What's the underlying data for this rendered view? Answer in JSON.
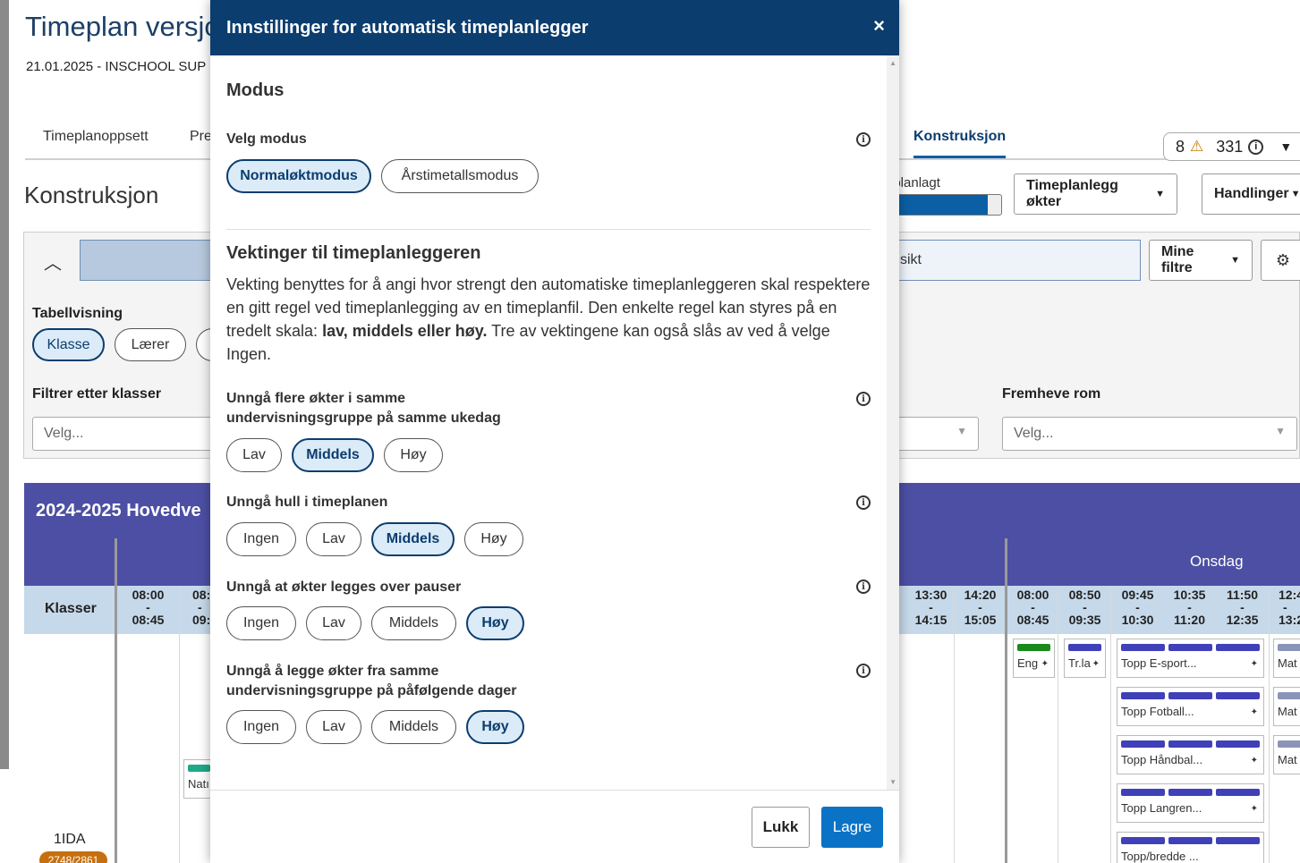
{
  "background": {
    "page_title": "Timeplan versjo",
    "subtitle": "21.01.2025 - INSCHOOL SUP",
    "tabs": [
      "Timeplanoppsett",
      "Pre",
      "Konstruksjon"
    ],
    "counts": {
      "warnings": "8",
      "info": "331"
    },
    "section_title": "Konstruksjon",
    "progress": {
      "label": "eplanlagt",
      "fraction": 0.88
    },
    "buttons": {
      "schedule": "Timeplanlegg økter",
      "actions": "Handlinger",
      "my_filters": "Mine filtre"
    },
    "search_right_text": "sikt",
    "tabellvisning": {
      "label": "Tabellvisning",
      "options": [
        "Klasse",
        "Lærer"
      ]
    },
    "filter_klasser": {
      "label": "Filtrer etter klasser",
      "placeholder": "Velg..."
    },
    "fremheve_rom": {
      "label": "Fremheve rom",
      "placeholder": "Velg..."
    },
    "grid": {
      "title": "2024-2025 Hovedve",
      "day": "Onsdag",
      "row_header": "Klasser",
      "times": [
        {
          "start": "08:00",
          "sep": "-",
          "end": "08:45"
        },
        {
          "start": "08:",
          "sep": "-",
          "end": "09:"
        },
        {
          "start": "13:30",
          "sep": "-",
          "end": "14:15"
        },
        {
          "start": "14:20",
          "sep": "-",
          "end": "15:05"
        },
        {
          "start": "08:00",
          "sep": "-",
          "end": "08:45"
        },
        {
          "start": "08:50",
          "sep": "-",
          "end": "09:35"
        },
        {
          "start": "09:45",
          "sep": "-",
          "end": "10:30"
        },
        {
          "start": "10:35",
          "sep": "-",
          "end": "11:20"
        },
        {
          "start": "11:50",
          "sep": "-",
          "end": "12:35"
        },
        {
          "start": "12:4",
          "sep": "-",
          "end": "13:2"
        }
      ],
      "cards": [
        "Eng",
        "Tr.la",
        "Topp E-sport...",
        "Topp Fotball...",
        "Topp Håndbal...",
        "Topp Langren...",
        "Topp/bredde ...",
        "Mat",
        "Mat",
        "Mat",
        "Natı"
      ],
      "row_label": "1IDA",
      "row_badge": "2748/2861"
    }
  },
  "modal": {
    "title": "Innstillinger for automatisk timeplanlegger",
    "close_glyph": "×",
    "modus_heading": "Modus",
    "velg_modus_label": "Velg modus",
    "modus_options": [
      "Normaløktmodus",
      "Årstimetallsmodus"
    ],
    "vekt_heading": "Vektinger til timeplanleggeren",
    "description_1": "Vekting benyttes for å angi hvor strengt den automatiske timeplanleggeren skal respektere en gitt regel ved timeplanlegging av en timeplanfil. Den enkelte regel kan styres på en tredelt skala: ",
    "description_bold": "lav, middels eller høy.",
    "description_2": " Tre av vektingene kan også slås av ved å velge Ingen.",
    "rules": [
      {
        "label": "Unngå flere økter i samme undervisningsgruppe på samme ukedag",
        "options": [
          "Lav",
          "Middels",
          "Høy"
        ],
        "selected": "Middels"
      },
      {
        "label": "Unngå hull i timeplanen",
        "options": [
          "Ingen",
          "Lav",
          "Middels",
          "Høy"
        ],
        "selected": "Middels"
      },
      {
        "label": "Unngå at økter legges over pauser",
        "options": [
          "Ingen",
          "Lav",
          "Middels",
          "Høy"
        ],
        "selected": "Høy"
      },
      {
        "label": "Unngå å legge økter fra samme undervisningsgruppe på påfølgende dager",
        "options": [
          "Ingen",
          "Lav",
          "Middels",
          "Høy"
        ],
        "selected": "Høy"
      }
    ],
    "footer": {
      "close": "Lukk",
      "save": "Lagre"
    }
  },
  "colors": {
    "header": "#0b3d6e",
    "primary": "#0b73c6",
    "selected_bg": "#dcebf8",
    "grid_header": "#4d4fa4",
    "badge": "#c66f0e"
  },
  "icons": [
    "close-icon",
    "info-icon",
    "warning-icon",
    "gear-icon",
    "chevron-up-icon",
    "chevron-down-icon",
    "caret-down-icon",
    "pin-icon"
  ]
}
